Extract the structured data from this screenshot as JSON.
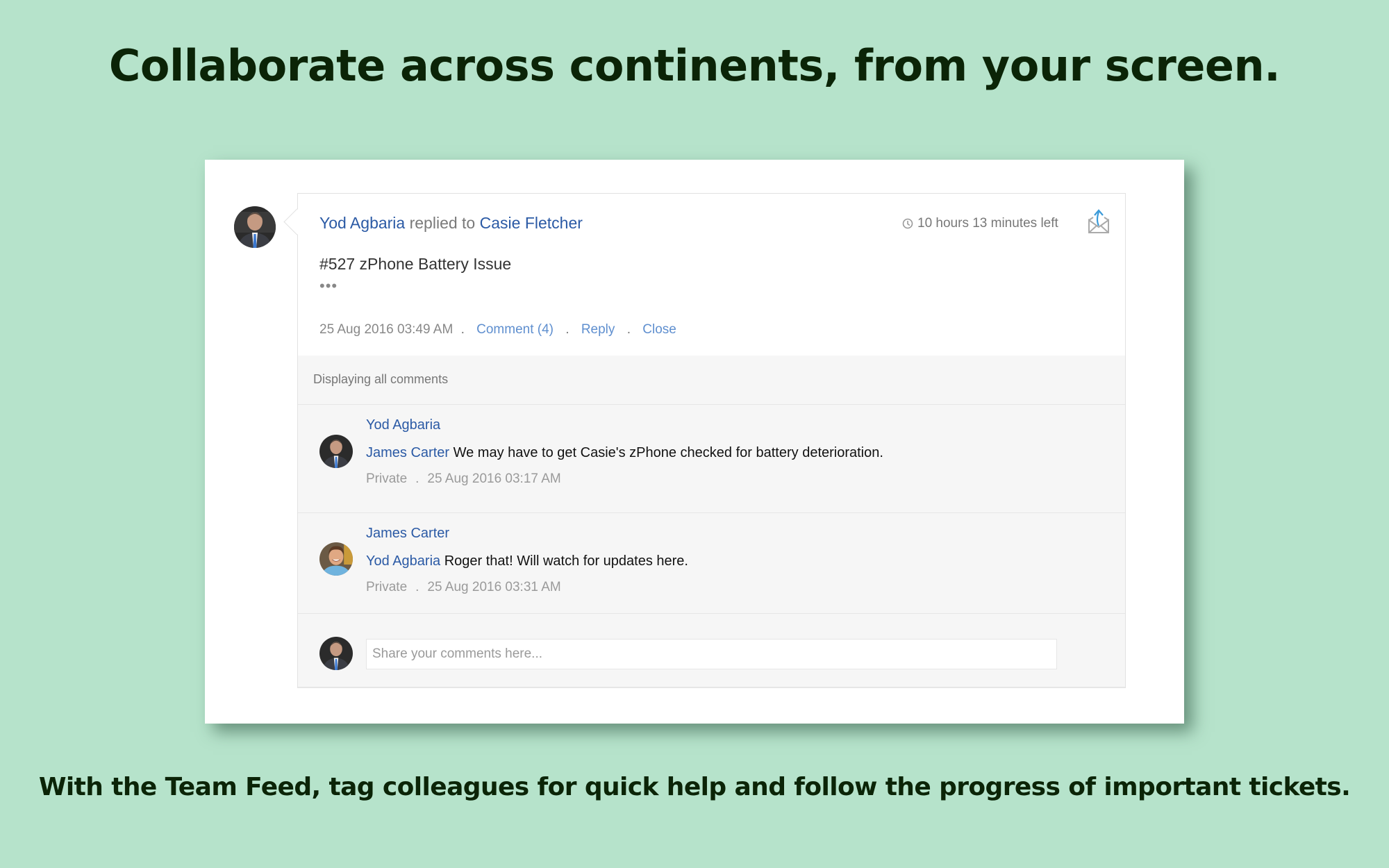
{
  "headline": "Collaborate across continents, from your screen.",
  "subline": "With the Team Feed, tag colleagues for quick help and follow the progress of important tickets.",
  "feed_item": {
    "author": "Yod Agbaria",
    "action_text": "replied to",
    "recipient": "Casie Fletcher",
    "timer_icon": "clock-icon",
    "timer": "10 hours 13 minutes left",
    "share_icon": "envelope-share-icon",
    "ticket_title": "#527 zPhone Battery Issue",
    "ellipsis": "•••",
    "timestamp": "25 Aug 2016 03:49 AM",
    "separator": ".",
    "actions": {
      "comment": "Comment (4)",
      "reply": "Reply",
      "close": "Close"
    }
  },
  "comments_section": {
    "header": "Displaying all comments",
    "comments": [
      {
        "author": "Yod Agbaria",
        "mention": "James Carter",
        "text": "We may have to get Casie's zPhone checked for battery deterioration.",
        "visibility": "Private",
        "separator": ".",
        "timestamp": "25 Aug 2016 03:17 AM"
      },
      {
        "author": "James Carter",
        "mention": "Yod Agbaria",
        "text": "Roger that! Will watch for updates here.",
        "visibility": "Private",
        "separator": ".",
        "timestamp": "25 Aug 2016 03:31 AM"
      }
    ],
    "compose": {
      "placeholder": "Share your comments here...",
      "value": ""
    }
  },
  "colors": {
    "background": "#b6e3cb",
    "headline": "#0b2407",
    "link": "#2b5aa5",
    "action_link": "#5f8fcf",
    "muted": "#888888"
  }
}
